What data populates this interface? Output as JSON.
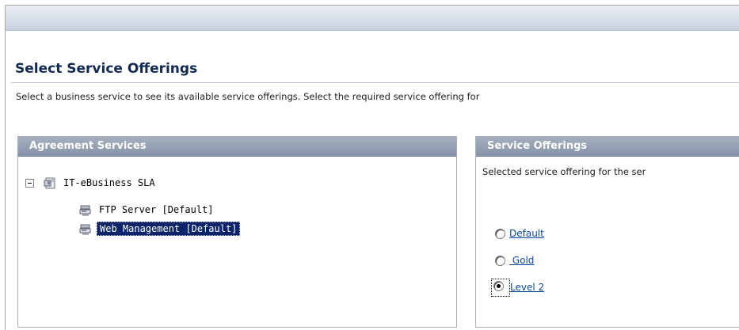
{
  "page": {
    "title": "Select Service Offerings",
    "description": "Select a business service to see its available service offerings. Select the required service offering for"
  },
  "agreement_panel": {
    "header": "Agreement Services",
    "tree": [
      {
        "label": "IT-eBusiness SLA",
        "expanded": true,
        "selected": false,
        "icon": "agreement-icon"
      },
      {
        "label": "FTP Server [Default]",
        "selected": false,
        "icon": "service-icon"
      },
      {
        "label": "Web Management [Default]",
        "selected": true,
        "icon": "service-icon"
      }
    ]
  },
  "offerings_panel": {
    "header": "Service Offerings",
    "description": "Selected service offering for the ser",
    "options": [
      {
        "label": "Default",
        "checked": false
      },
      {
        "label": " Gold",
        "checked": false
      },
      {
        "label": "Level 2",
        "checked": true
      }
    ]
  },
  "colors": {
    "panel_header": "#8c98ab",
    "title": "#112a52",
    "link": "#0b4aa2",
    "selection": "#0a246a"
  }
}
